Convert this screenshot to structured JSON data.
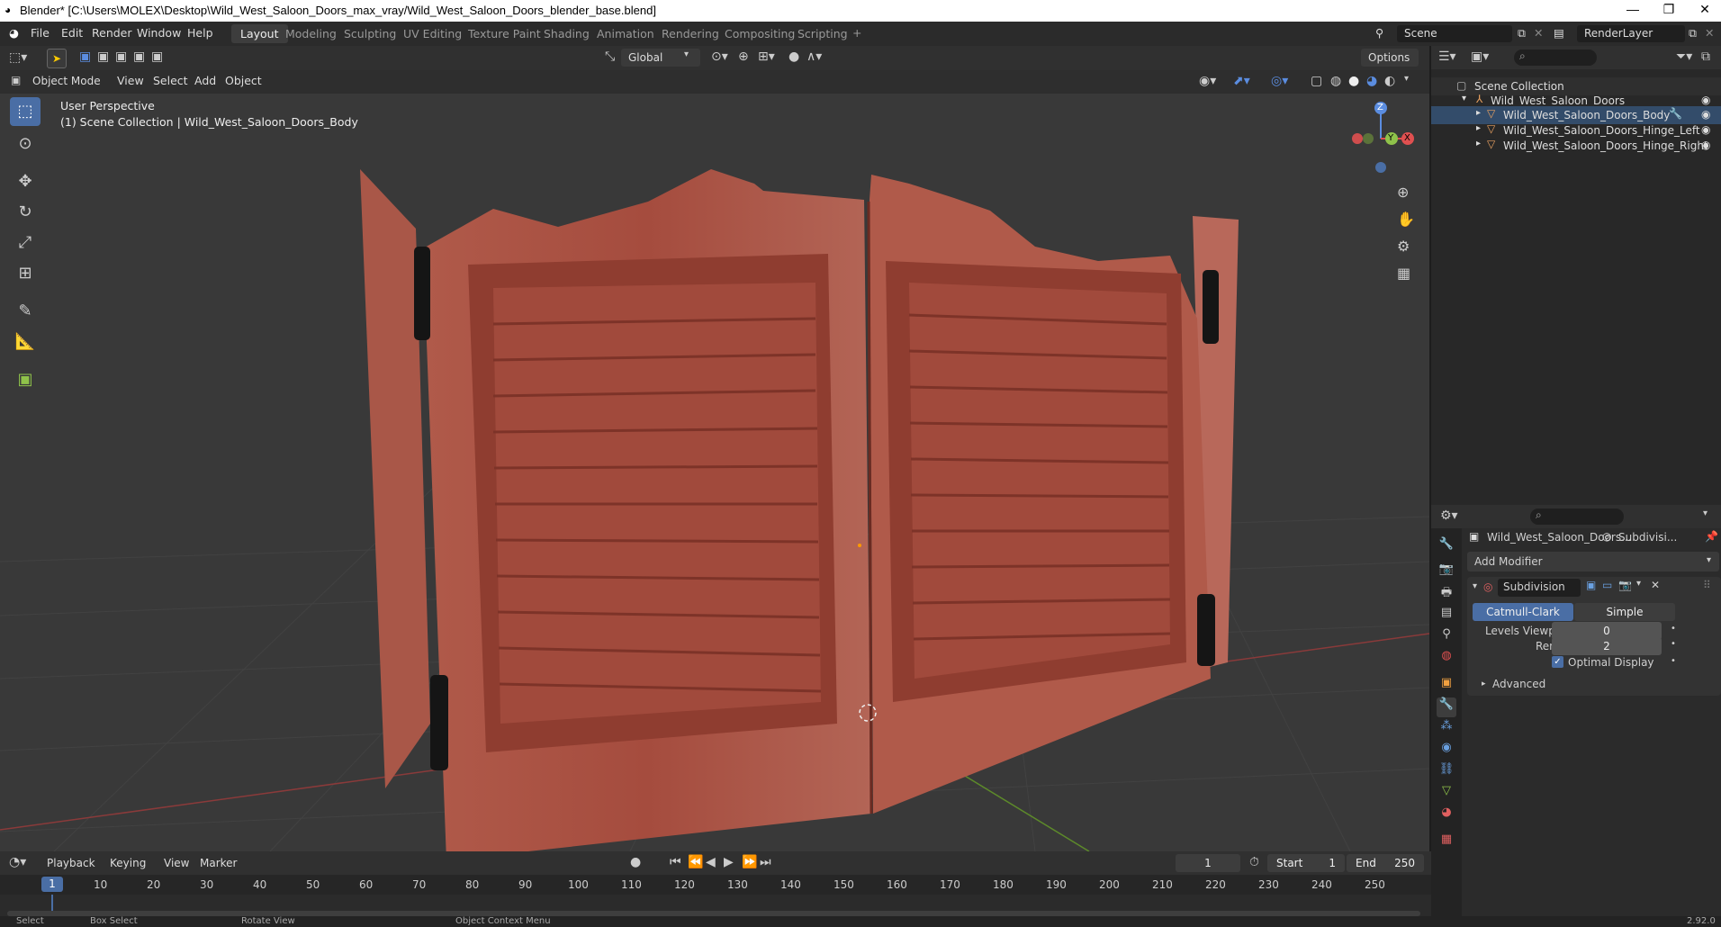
{
  "window": {
    "title": "Blender* [C:\\Users\\MOLEX\\Desktop\\Wild_West_Saloon_Doors_max_vray/Wild_West_Saloon_Doors_blender_base.blend]",
    "minimize": "—",
    "maximize": "❐",
    "close": "✕"
  },
  "menu": [
    "File",
    "Edit",
    "Render",
    "Window",
    "Help"
  ],
  "workspaces": [
    "Layout",
    "Modeling",
    "Sculpting",
    "UV Editing",
    "Texture Paint",
    "Shading",
    "Animation",
    "Rendering",
    "Compositing",
    "Scripting"
  ],
  "scene": {
    "label": "Scene",
    "render_layer": "RenderLayer"
  },
  "viewport_header": {
    "transform_orientation": "Global",
    "options": "Options",
    "mode": "Object Mode",
    "menus": [
      "View",
      "Select",
      "Add",
      "Object"
    ]
  },
  "viewport": {
    "perspective": "User Perspective",
    "collection_info": "(1) Scene Collection | Wild_West_Saloon_Doors_Body"
  },
  "gizmo": {
    "z": "Z",
    "y": "Y",
    "x": "X"
  },
  "outliner": {
    "root": "Scene Collection",
    "collection": "Wild_West_Saloon_Doors",
    "objects": [
      "Wild_West_Saloon_Doors_Body",
      "Wild_West_Saloon_Doors_Hinge_Left",
      "Wild_West_Saloon_Doors_Hinge_Right"
    ]
  },
  "properties": {
    "object_name": "Wild_West_Saloon_Doors...",
    "modifier_short": "Subdivisi...",
    "add_modifier": "Add Modifier",
    "modifier_name": "Subdivision",
    "type_catmull": "Catmull-Clark",
    "type_simple": "Simple",
    "levels_viewport_label": "Levels Viewport",
    "levels_viewport_value": "0",
    "render_label": "Render",
    "render_value": "2",
    "optimal_display": "Optimal Display",
    "advanced": "Advanced"
  },
  "timeline": {
    "menus": [
      "Playback",
      "Keying",
      "View",
      "Marker"
    ],
    "current_frame": "1",
    "start_label": "Start",
    "start_value": "1",
    "end_label": "End",
    "end_value": "250",
    "ruler": [
      "1",
      "10",
      "20",
      "30",
      "40",
      "50",
      "60",
      "70",
      "80",
      "90",
      "100",
      "110",
      "120",
      "130",
      "140",
      "150",
      "160",
      "170",
      "180",
      "190",
      "200",
      "210",
      "220",
      "230",
      "240",
      "250"
    ]
  },
  "statusbar": {
    "select": "Select",
    "box_select": "Box Select",
    "rotate_view": "Rotate View",
    "context_menu": "Object Context Menu",
    "version": "2.92.0"
  },
  "colors": {
    "accent": "#4a6ea5",
    "door_wood": "#a14a3c",
    "door_dark": "#7d3328",
    "hinge": "#151515"
  }
}
